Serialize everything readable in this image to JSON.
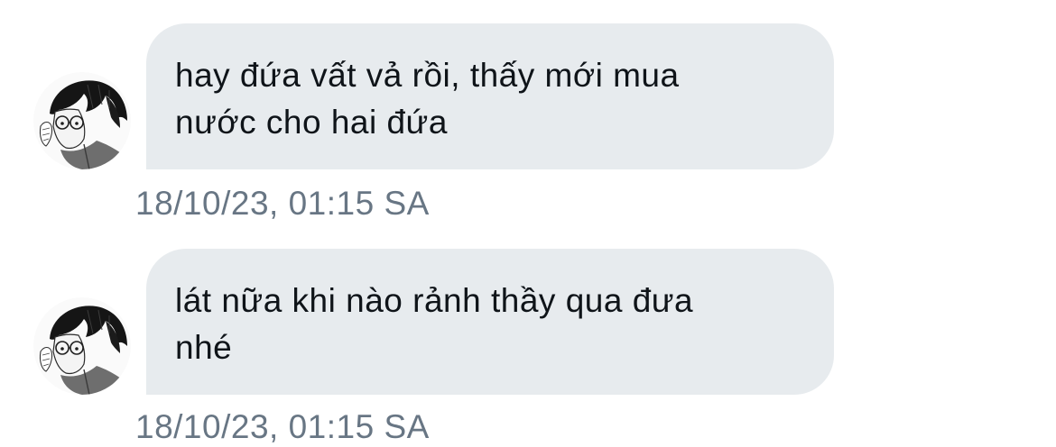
{
  "colors": {
    "bubble_background": "#e7ebee",
    "message_text": "#0f1419",
    "timestamp_text": "#687684",
    "page_background": "#ffffff"
  },
  "messages": [
    {
      "avatar_icon": "manga-avatar",
      "text": "hay đứa vất vả rồi, thấy mới mua\nnước cho hai đứa",
      "timestamp": "18/10/23, 01:15 SA"
    },
    {
      "avatar_icon": "manga-avatar",
      "text": "lát nữa khi nào rảnh thầy qua đưa\nnhé",
      "timestamp": "18/10/23, 01:15 SA"
    }
  ]
}
